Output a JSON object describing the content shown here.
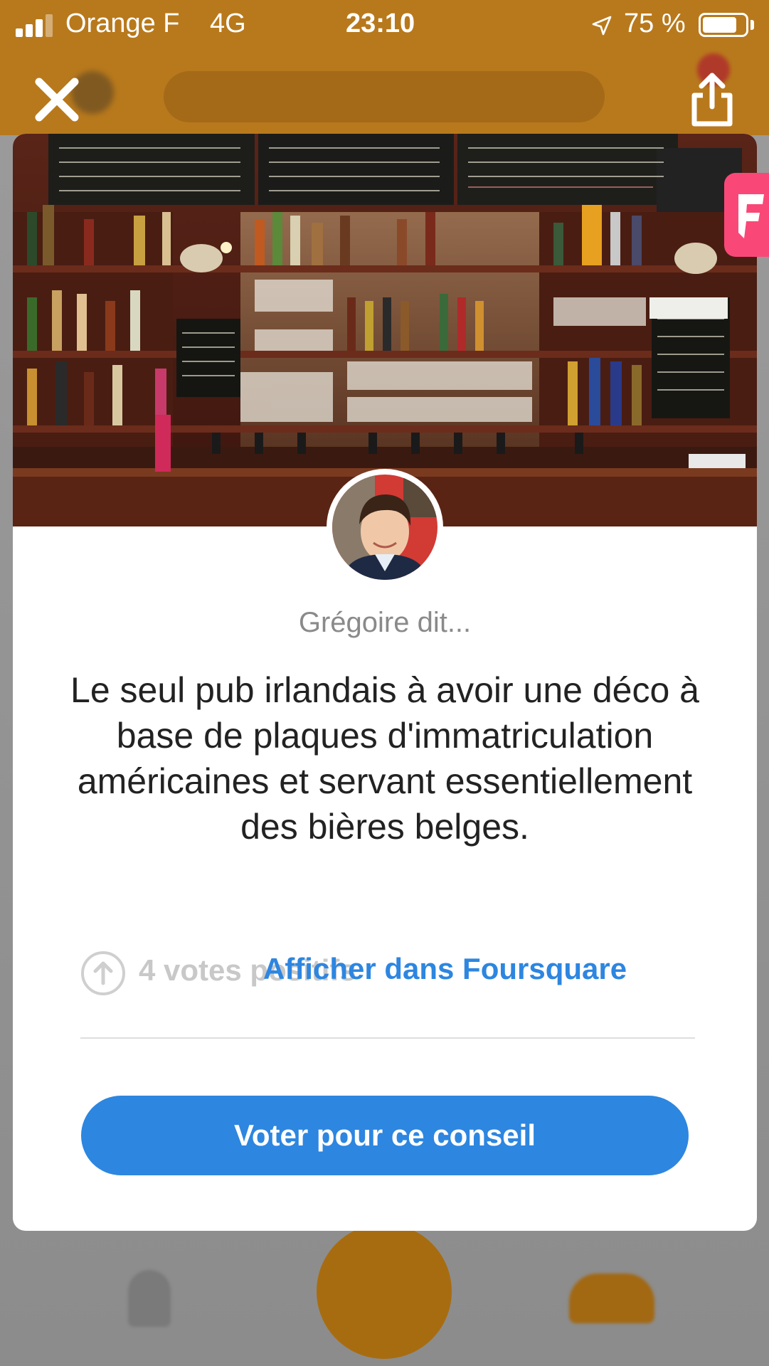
{
  "status_bar": {
    "carrier": "Orange F",
    "network": "4G",
    "time": "23:10",
    "battery": "75 %",
    "battery_level": 0.75
  },
  "icons": {
    "close": "close-icon",
    "share": "share-icon",
    "foursquare": "foursquare-logo-icon",
    "upvote": "arrow-up-circle-icon",
    "location": "location-arrow-icon"
  },
  "tip": {
    "author": "Grégoire dit...",
    "text": "Le seul pub irlandais à avoir une déco à base de plaques d'immatriculation américaines et servant essentiellement des bières belges.",
    "votes": "4 votes positifs",
    "link_label": "Afficher dans Foursquare",
    "vote_button": "Voter pour ce conseil"
  },
  "colors": {
    "accent": "#2d86e0",
    "brand_pink": "#f94877",
    "top_bar": "#b8791c"
  }
}
